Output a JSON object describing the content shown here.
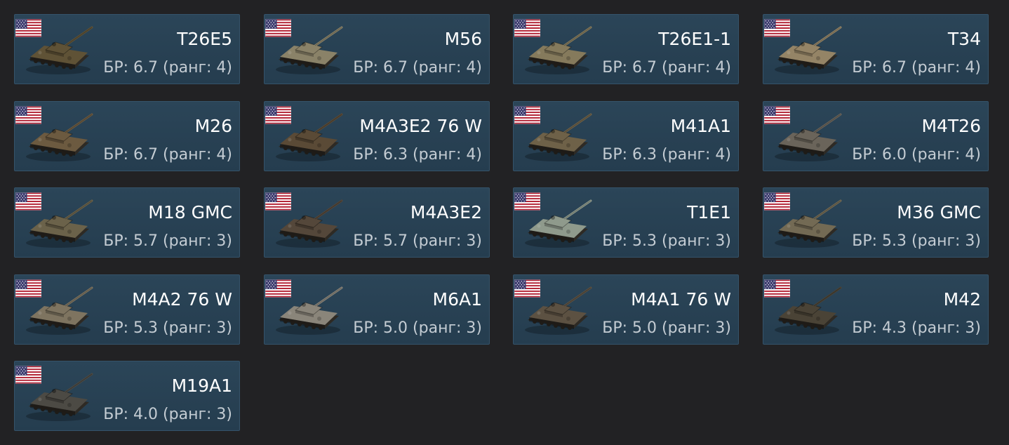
{
  "nation": "usa",
  "nation_icon": "usa-flag-icon",
  "vehicle_icon": "tank-icon",
  "colors": {
    "background": "#222224",
    "card_background": "#2b4558",
    "card_border": "#35536a",
    "name_text": "#ffffff",
    "br_text": "#c4ccd3"
  },
  "vehicles": [
    {
      "name": "T26E5",
      "br": "БР: 6.7 (ранг: 4)",
      "camo": "#5f5236"
    },
    {
      "name": "M56",
      "br": "БР: 6.7 (ранг: 4)",
      "camo": "#8a8268"
    },
    {
      "name": "T26E1-1",
      "br": "БР: 6.7 (ранг: 4)",
      "camo": "#857a5c"
    },
    {
      "name": "T34",
      "br": "БР: 6.7 (ранг: 4)",
      "camo": "#948466"
    },
    {
      "name": "M26",
      "br": "БР: 6.7 (ранг: 4)",
      "camo": "#6c5a40"
    },
    {
      "name": "M4A3E2 76 W",
      "br": "БР: 6.3 (ранг: 4)",
      "camo": "#5a4a36"
    },
    {
      "name": "M41A1",
      "br": "БР: 6.3 (ранг: 4)",
      "camo": "#6e6148"
    },
    {
      "name": "M4T26",
      "br": "БР: 6.0 (ранг: 4)",
      "camo": "#6a645a"
    },
    {
      "name": "M18 GMC",
      "br": "БР: 5.7 (ранг: 3)",
      "camo": "#6b624a"
    },
    {
      "name": "M4A3E2",
      "br": "БР: 5.7 (ранг: 3)",
      "camo": "#54473a"
    },
    {
      "name": "T1E1",
      "br": "БР: 5.3 (ранг: 3)",
      "camo": "#8f9a8c"
    },
    {
      "name": "M36 GMC",
      "br": "БР: 5.3 (ранг: 3)",
      "camo": "#736a54"
    },
    {
      "name": "M4A2 76 W",
      "br": "БР: 5.3 (ранг: 3)",
      "camo": "#7e7460"
    },
    {
      "name": "M6A1",
      "br": "БР: 5.0 (ранг: 3)",
      "camo": "#8a857a"
    },
    {
      "name": "M4A1 76 W",
      "br": "БР: 5.0 (ранг: 3)",
      "camo": "#5c5142"
    },
    {
      "name": "M42",
      "br": "БР: 4.3 (ранг: 3)",
      "camo": "#4a4336"
    },
    {
      "name": "M19A1",
      "br": "БР: 4.0 (ранг: 3)",
      "camo": "#4c4a44"
    }
  ]
}
